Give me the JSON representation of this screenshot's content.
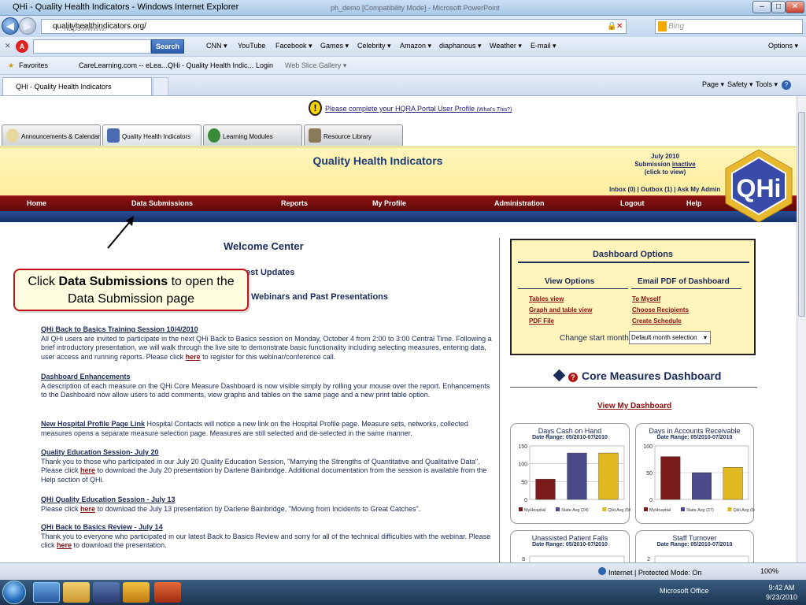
{
  "browser": {
    "window_title": "QHi - Quality Health Indicators - Windows Internet Explorer",
    "ghost_title": "ph_demo [Compatibility Mode] - Microsoft PowerPoint",
    "url_prefix": "https://www.",
    "url_main": "qualityhealthindicators.org/",
    "search_placeholder": "Bing",
    "toolbar": {
      "search_button": "Search",
      "items": [
        "CNN ▾",
        "YouTube",
        "Facebook ▾",
        "Games ▾",
        "Celebrity ▾",
        "Amazon ▾",
        "diaphanous ▾",
        "Weather ▾",
        "E-mail ▾"
      ],
      "options": "Options ▾"
    },
    "favorites": {
      "label": "Favorites",
      "items": [
        "CareLearning.com -- eLea...",
        "QHi - Quality Health Indic...",
        "Login",
        "Web Slice Gallery ▾"
      ]
    },
    "tab_title": "QHi - Quality Health Indicators",
    "commands": [
      "Page ▾",
      "Safety ▾",
      "Tools ▾"
    ],
    "status_zone": "Internet | Protected Mode: On",
    "zoom": "100%"
  },
  "notice": {
    "text": "Please complete your HQRA Portal User Profile",
    "small": "(What's This?)"
  },
  "app_tabs": [
    "Announcements & Calendar",
    "Quality Health Indicators",
    "Learning Modules",
    "Resource Library"
  ],
  "banner": {
    "title": "Quality Health Indicators",
    "month": "July 2010",
    "submission_prefix": "Submission",
    "submission_status": "inactive",
    "click_to_view": "(click to view)",
    "inbox": "Inbox (0) | Outbox (1) | Ask My Admin",
    "logo_text": "QHi"
  },
  "nav": [
    "Home",
    "Data Submissions",
    "Reports",
    "My Profile",
    "Administration",
    "Logout",
    "Help"
  ],
  "welcome": "Welcome Center",
  "headings_partial": {
    "latest": "est Updates",
    "webinars": "Webinars and Past Presentations"
  },
  "callout": {
    "pre": "Click",
    "bold": "Data Submissions",
    "post": "to open the Data Submission page"
  },
  "news": [
    {
      "title": "QHi Back to Basics Training Session 10/4/2010",
      "body1": "All QHi users are invited to participate in the next QHi Back to Basics session on Monday, October 4 from 2:00 to 3:00 Central Time. Following a brief introductory presentation, we will walk through the live site to demonstrate basic functionality including selecting measures, entering data, user access and running reports. Please click",
      "link": "here",
      "body2": "to register for this webinar/conference call."
    },
    {
      "title": "Dashboard Enhancements",
      "body1": "A description of each measure on the QHi Core Measure Dashboard is now visible simply by rolling your mouse over the report. Enhancements to the Dashboard now allow users to add comments, view graphs and tables on the same page and a new print table option."
    },
    {
      "title": "New Hospital Profile Page Link",
      "body1": "Hospital Contacts will notice a new link on the Hospital Profile page. Measure sets, networks, collected measures opens a separate measure selection page. Measures are still selected and de-selected in the same manner."
    },
    {
      "title": "Quality Education Session- July 20",
      "body1": "Thank you to those who participated in our July 20 Quality Education Session, \"Marrying the Strengths of Quantitative and Qualitative Data\". Please click",
      "link": "here",
      "body2": "to download the July 20 presentation by Darlene Bainbridge. Additional documentation from the session is available from the Help section of QHi."
    },
    {
      "title": "QHi Quality Education Session - July 13",
      "body1": "Please click",
      "link": "here",
      "body2": "to download the July 13 presentation by Darlene Bainbridge, \"Moving from Incidents to Great Catches\"."
    },
    {
      "title": "QHi Back to Basics Review - July 14",
      "body1": "Thank you to everyone who participated in our latest Back to Basics Review and sorry for all of the technical difficulties with the webinar. Please click",
      "link": "here",
      "body2": "to download the presentation."
    }
  ],
  "dashboard_options": {
    "title": "Dashboard Options",
    "view_title": "View Options",
    "view_links": [
      "Tables view",
      "Graph and table view",
      "PDF File"
    ],
    "email_title": "Email PDF of Dashboard",
    "email_links": [
      "To Myself",
      "Choose Recipients",
      "Create Schedule"
    ],
    "start_month_label": "Change start month:",
    "start_month_value": "Default month selection"
  },
  "core": {
    "title": "Core Measures Dashboard",
    "view_link": "View My Dashboard"
  },
  "colors": {
    "myhospital": "#7a1a1a",
    "state": "#4a4a8a",
    "qhi": "#e0b820",
    "nav": "#7a0e0e",
    "banner": "#fff1a8"
  },
  "chart_data": [
    {
      "type": "bar",
      "title": "Days Cash on Hand",
      "subtitle": "Date Range: 05/2010-07/2010",
      "categories": [
        "MyHospital",
        "State Avg (24)",
        "QHi Avg (64)"
      ],
      "values": [
        57,
        130,
        130
      ],
      "ylim": [
        0,
        150
      ],
      "yticks": [
        0,
        50,
        100,
        150
      ],
      "grid": true
    },
    {
      "type": "bar",
      "title": "Days in Accounts Receivable",
      "subtitle": "Date Range: 05/2010-07/2010",
      "categories": [
        "MyHospital",
        "State Avg (27)",
        "QHi Avg (64)"
      ],
      "values": [
        80,
        50,
        60
      ],
      "ylim": [
        0,
        100
      ],
      "yticks": [
        0,
        50,
        100
      ],
      "grid": true
    },
    {
      "type": "bar",
      "title": "Unassisted Patient Falls",
      "subtitle": "Date Range: 05/2010-07/2010",
      "yticks": [
        8
      ]
    },
    {
      "type": "bar",
      "title": "Staff Turnover",
      "subtitle": "Date Range: 05/2010-07/2010",
      "yticks": [
        2
      ]
    }
  ],
  "taskbar": {
    "office": "Microsoft Office",
    "time": "9:42 AM",
    "date": "9/23/2010"
  }
}
